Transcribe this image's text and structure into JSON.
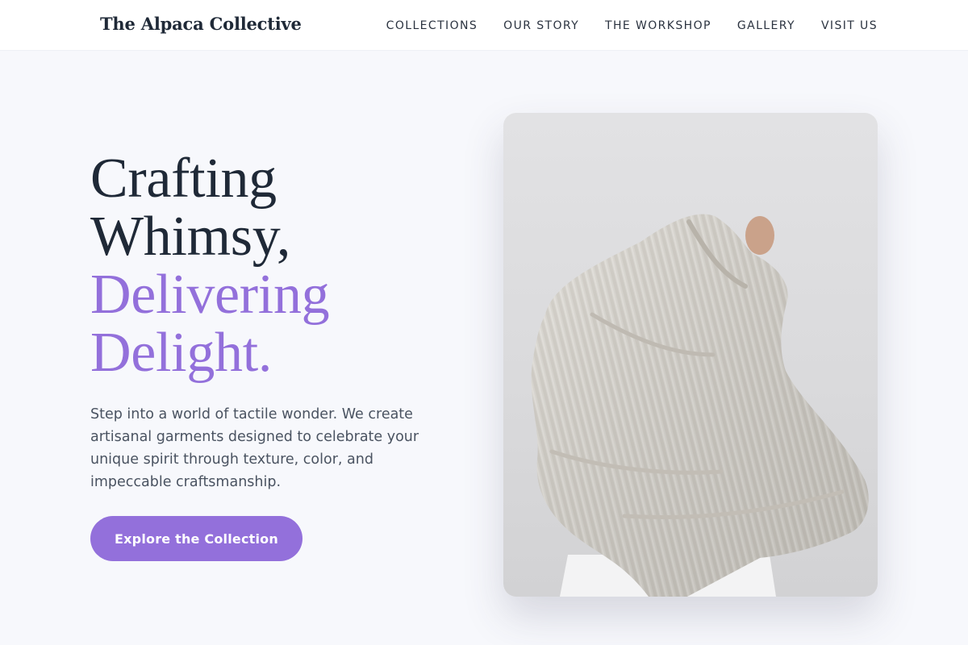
{
  "header": {
    "brand": "The Alpaca Collective",
    "nav": [
      {
        "label": "COLLECTIONS"
      },
      {
        "label": "OUR STORY"
      },
      {
        "label": "THE WORKSHOP"
      },
      {
        "label": "GALLERY"
      },
      {
        "label": "VISIT US"
      }
    ]
  },
  "hero": {
    "headline_line1": "Crafting",
    "headline_line2": "Whimsy,",
    "headline_accent1": "Delivering",
    "headline_accent2": "Delight.",
    "description": "Step into a world of tactile wonder. We create artisanal garments designed to celebrate your unique spirit through texture, color, and impeccable craftsmanship.",
    "cta_label": "Explore the Collection",
    "image_alt": "Person pulling on an oversized cream knit sweater"
  },
  "colors": {
    "accent": "#9370db",
    "text": "#1f2937",
    "background": "#f7f8fc"
  }
}
